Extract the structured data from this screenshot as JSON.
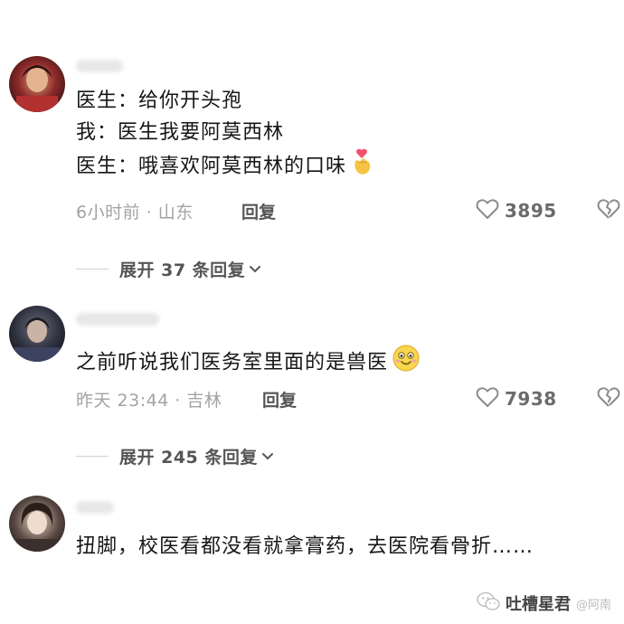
{
  "comments": [
    {
      "lines": [
        "医生：给你开头孢",
        "我：医生我要阿莫西林",
        "医生：哦喜欢阿莫西林的口味"
      ],
      "emoji": "finger-heart",
      "meta": "6小时前 · 山东",
      "reply_label": "回复",
      "likes": "3895",
      "expand_label": "展开 37 条回复"
    },
    {
      "lines": [
        "之前听说我们医务室里面的是兽医"
      ],
      "emoji": "grinning-face",
      "meta": "昨天 23:44 · 吉林",
      "reply_label": "回复",
      "likes": "7938",
      "expand_label": "展开 245 条回复"
    },
    {
      "lines": [
        "扭脚，校医看都没看就拿膏药，去医院看骨折……"
      ]
    }
  ],
  "watermark": {
    "brand": "吐槽星君",
    "handle": "@阿南"
  },
  "colors": {
    "text": "#161616",
    "meta": "#a3a3a3",
    "action": "#555555",
    "background": "#ffffff"
  }
}
